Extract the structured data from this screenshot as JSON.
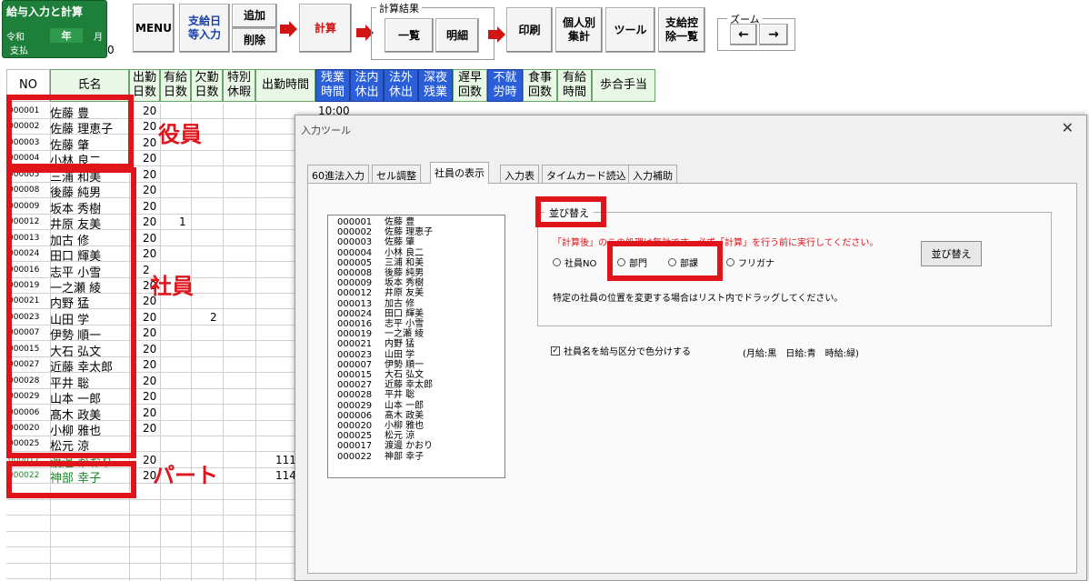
{
  "toolbar": {
    "title": "給与入力と計算",
    "era": "令和",
    "year_label": "年",
    "month_label": "月",
    "pay_label": "支払",
    "zero_value": "0",
    "menu": "MENU",
    "paydate_line1": "支給日",
    "paydate_line2": "等入力",
    "add": "追加",
    "delete": "削除",
    "calc": "計算",
    "calc_result_group": "計算結果",
    "list": "一覧",
    "detail": "明細",
    "print": "印刷",
    "indiv_line1": "個人別",
    "indiv_line2": "集計",
    "tools": "ツール",
    "deduct_line1": "支給控",
    "deduct_line2": "除一覧",
    "zoom_group": "ズーム",
    "zoom_left": "←",
    "zoom_right": "→"
  },
  "columns": {
    "no": "NO",
    "name": "氏名",
    "h1a": "出勤",
    "h1b": "日数",
    "h2a": "有給",
    "h2b": "日数",
    "h3a": "欠勤",
    "h3b": "日数",
    "h4a": "特別",
    "h4b": "休暇",
    "h5": "出勤時間",
    "h6a": "残業",
    "h6b": "時間",
    "h7a": "法内",
    "h7b": "休出",
    "h8a": "法外",
    "h8b": "休出",
    "h9a": "深夜",
    "h9b": "残業",
    "h10a": "遅早",
    "h10b": "回数",
    "h11a": "不就",
    "h11b": "労時",
    "h12a": "食事",
    "h12b": "回数",
    "h13a": "有給",
    "h13b": "時間",
    "h14": "歩合手当"
  },
  "overtime_first": "10:00",
  "rows": [
    {
      "no": "000001",
      "name": "佐藤 豊",
      "days": "20",
      "paid": "",
      "absent": "",
      "hours": ""
    },
    {
      "no": "000002",
      "name": "佐藤 理恵子",
      "days": "20",
      "paid": "",
      "absent": "",
      "hours": ""
    },
    {
      "no": "000003",
      "name": "佐藤 肇",
      "days": "20",
      "paid": "",
      "absent": "",
      "hours": ""
    },
    {
      "no": "000004",
      "name": "小林 良二",
      "days": "20",
      "paid": "",
      "absent": "",
      "hours": ""
    },
    {
      "no": "000005",
      "name": "三浦 和美",
      "days": "20",
      "paid": "",
      "absent": "",
      "hours": ""
    },
    {
      "no": "000008",
      "name": "後藤 純男",
      "days": "20",
      "paid": "",
      "absent": "",
      "hours": ""
    },
    {
      "no": "000009",
      "name": "坂本 秀樹",
      "days": "20",
      "paid": "",
      "absent": "",
      "hours": ""
    },
    {
      "no": "000012",
      "name": "井原 友美",
      "days": "20",
      "paid": "1",
      "absent": "",
      "hours": ""
    },
    {
      "no": "000013",
      "name": "加古 修",
      "days": "20",
      "paid": "",
      "absent": "",
      "hours": ""
    },
    {
      "no": "000024",
      "name": "田口 輝美",
      "days": "20",
      "paid": "",
      "absent": "",
      "hours": ""
    },
    {
      "no": "000016",
      "name": "志平 小雪",
      "days": "2",
      "paid": "",
      "absent": "",
      "hours": ""
    },
    {
      "no": "000019",
      "name": "一之瀬 綾",
      "days": "20",
      "paid": "",
      "absent": "",
      "hours": ""
    },
    {
      "no": "000021",
      "name": "内野 猛",
      "days": "20",
      "paid": "",
      "absent": "",
      "hours": ""
    },
    {
      "no": "000023",
      "name": "山田 学",
      "days": "20",
      "paid": "",
      "absent": "2",
      "hours": ""
    },
    {
      "no": "000007",
      "name": "伊勢 順一",
      "days": "20",
      "paid": "",
      "absent": "",
      "hours": ""
    },
    {
      "no": "000015",
      "name": "大石 弘文",
      "days": "20",
      "paid": "",
      "absent": "",
      "hours": ""
    },
    {
      "no": "000027",
      "name": "近藤 幸太郎",
      "days": "20",
      "paid": "",
      "absent": "",
      "hours": ""
    },
    {
      "no": "000028",
      "name": "平井 聡",
      "days": "20",
      "paid": "",
      "absent": "",
      "hours": ""
    },
    {
      "no": "000029",
      "name": "山本 一郎",
      "days": "20",
      "paid": "",
      "absent": "",
      "hours": ""
    },
    {
      "no": "000006",
      "name": "髙木 政美",
      "days": "20",
      "paid": "",
      "absent": "",
      "hours": ""
    },
    {
      "no": "000020",
      "name": "小柳 雅也",
      "days": "20",
      "paid": "",
      "absent": "",
      "hours": ""
    },
    {
      "no": "000025",
      "name": "松元 涼",
      "days": "",
      "paid": "",
      "absent": "",
      "hours": ""
    },
    {
      "no": "000017",
      "name": "渡邊 かおり",
      "days": "20",
      "paid": "",
      "absent": "",
      "hours": "111"
    },
    {
      "no": "000022",
      "name": "神部 幸子",
      "days": "20",
      "paid": "",
      "absent": "",
      "hours": "114"
    }
  ],
  "annotations": {
    "officers": "役員",
    "employees": "社員",
    "parttime": "パート"
  },
  "dialog": {
    "title": "入力ツール",
    "close": "✕",
    "tabs": [
      "60進法入力",
      "セル調整",
      "社員の表示",
      "入力表",
      "タイムカード読込",
      "入力補助"
    ],
    "list_items": [
      {
        "code": "000001",
        "name": "佐藤 豊"
      },
      {
        "code": "000002",
        "name": "佐藤 理恵子"
      },
      {
        "code": "000003",
        "name": "佐藤 肇"
      },
      {
        "code": "000004",
        "name": "小林 良二"
      },
      {
        "code": "000005",
        "name": "三浦 和美"
      },
      {
        "code": "000008",
        "name": "後藤 純男"
      },
      {
        "code": "000009",
        "name": "坂本 秀樹"
      },
      {
        "code": "000012",
        "name": "井原 友美"
      },
      {
        "code": "000013",
        "name": "加古 修"
      },
      {
        "code": "000024",
        "name": "田口 輝美"
      },
      {
        "code": "000016",
        "name": "志平 小雪"
      },
      {
        "code": "000019",
        "name": "一之瀬 綾"
      },
      {
        "code": "000021",
        "name": "内野 猛"
      },
      {
        "code": "000023",
        "name": "山田 学"
      },
      {
        "code": "000007",
        "name": "伊勢 順一"
      },
      {
        "code": "000015",
        "name": "大石 弘文"
      },
      {
        "code": "000027",
        "name": "近藤 幸太郎"
      },
      {
        "code": "000028",
        "name": "平井 聡"
      },
      {
        "code": "000029",
        "name": "山本 一郎"
      },
      {
        "code": "000006",
        "name": "髙木 政美"
      },
      {
        "code": "000020",
        "name": "小柳 雅也"
      },
      {
        "code": "000025",
        "name": "松元 涼"
      },
      {
        "code": "000017",
        "name": "渡邊 かおり"
      },
      {
        "code": "000022",
        "name": "神部 幸子"
      }
    ],
    "sort_frame_label": "並び替え",
    "warning": "「計算後」のこの処理は無効です。必ず「計算」を行う前に実行してください。",
    "radio_emp_no": "社員NO",
    "radio_dept": "部門",
    "radio_section": "部課",
    "radio_furigana": "フリガナ",
    "sort_button": "並び替え",
    "note": "特定の社員の位置を変更する場合はリスト内でドラッグしてください。",
    "check_label": "社員名を給与区分で色分けする",
    "check_mark": "✓",
    "legend": "(月給:黒　日給:青　時給:緑)"
  }
}
